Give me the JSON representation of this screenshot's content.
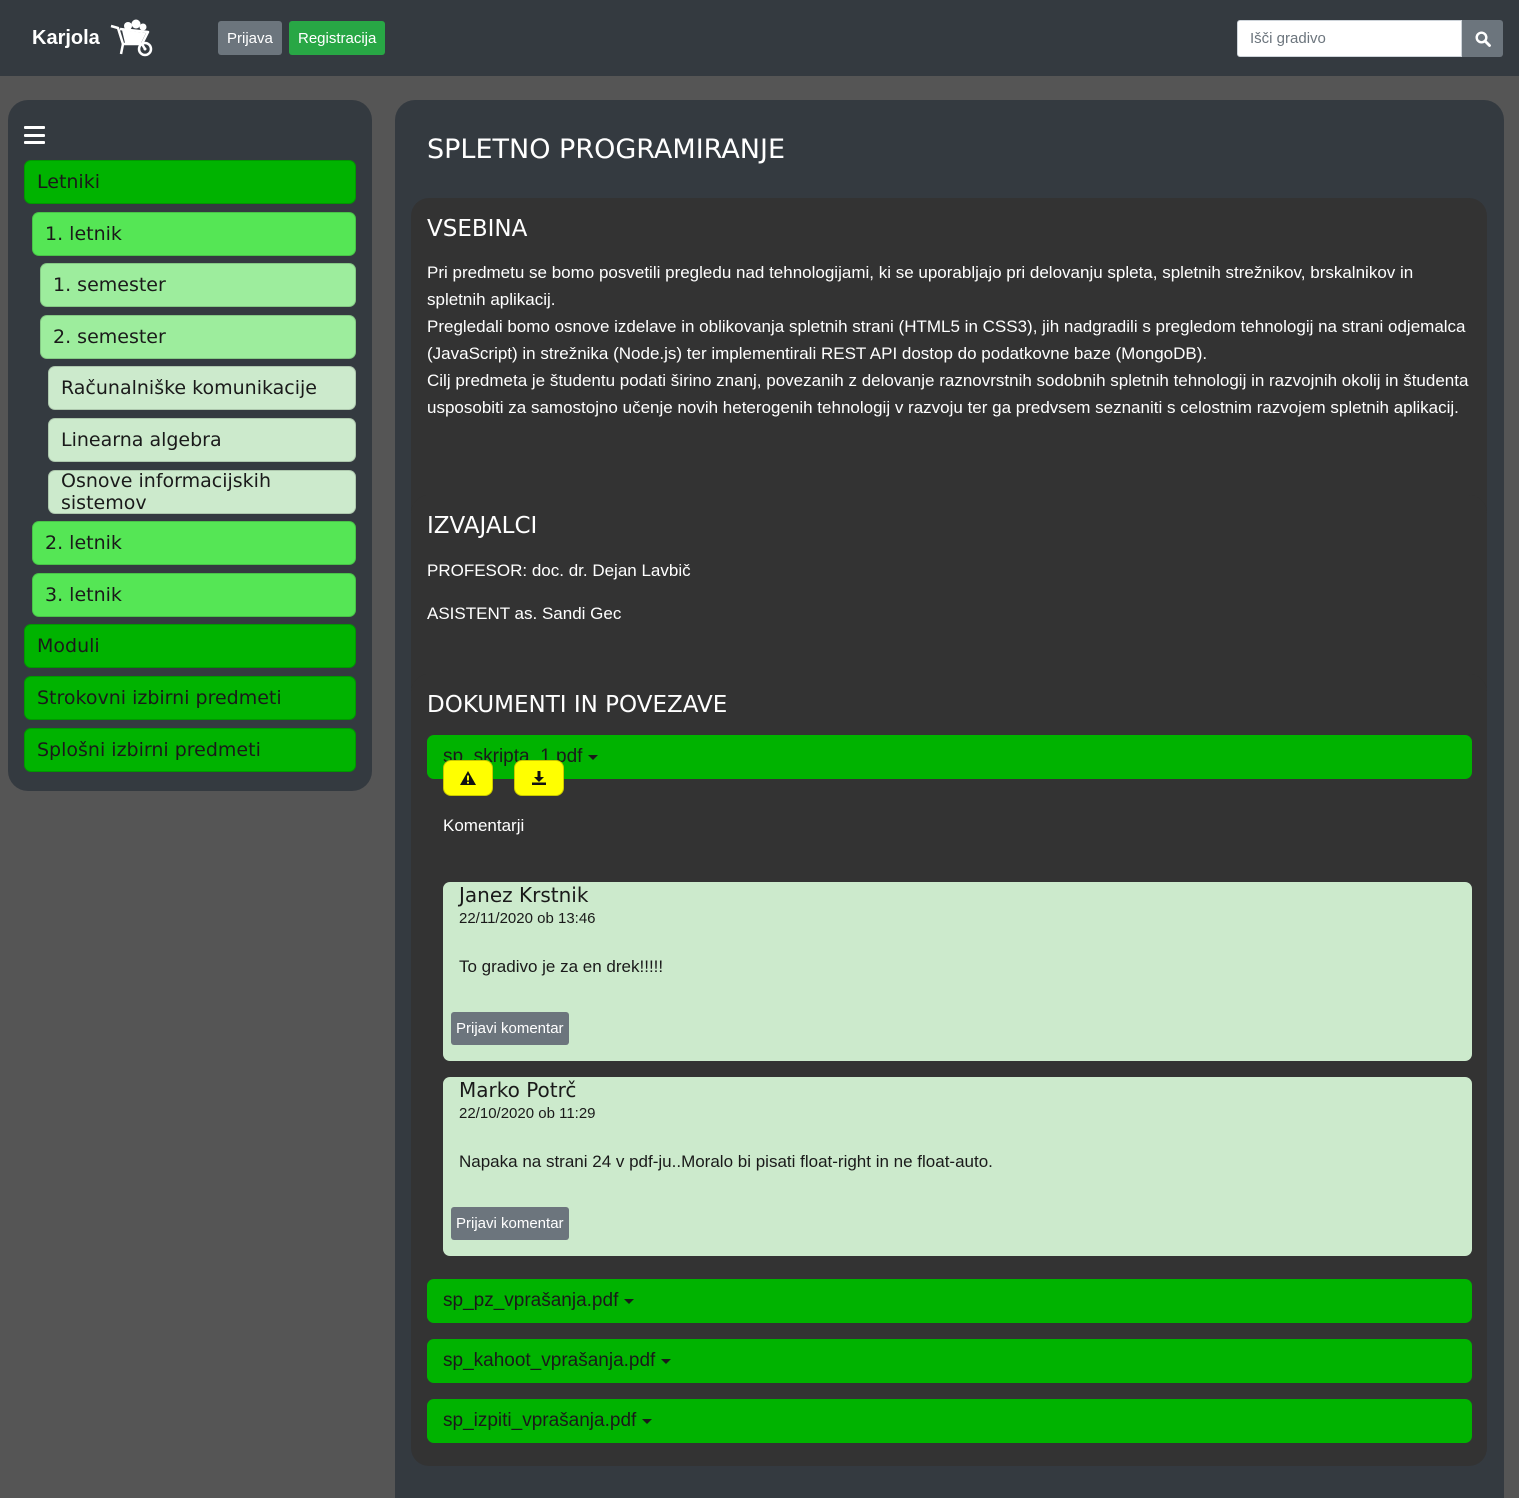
{
  "navbar": {
    "brand": "Karjola",
    "login_label": "Prijava",
    "register_label": "Registracija",
    "search_placeholder": "Išči gradivo",
    "search_icon": "search-icon"
  },
  "sidebar": {
    "menu_icon": "hamburger-menu-icon",
    "items": [
      {
        "label": "Letniki"
      },
      {
        "label": "1. letnik"
      },
      {
        "label": "1. semester"
      },
      {
        "label": "2. semester"
      },
      {
        "label": "Računalniške komunikacije"
      },
      {
        "label": "Linearna algebra"
      },
      {
        "label": "Osnove informacijskih sistemov"
      },
      {
        "label": "2. letnik"
      },
      {
        "label": "3. letnik"
      },
      {
        "label": "Moduli"
      },
      {
        "label": "Strokovni izbirni predmeti"
      },
      {
        "label": "Splošni izbirni predmeti"
      }
    ]
  },
  "main": {
    "title": "SPLETNO PROGRAMIRANJE",
    "vsebina": {
      "title": "VSEBINA",
      "p1": "Pri predmetu se bomo posvetili pregledu nad tehnologijami, ki se uporabljajo pri delovanju spleta, spletnih strežnikov, brskalnikov in spletnih aplikacij.",
      "p2": "Pregledali bomo osnove izdelave in oblikovanja spletnih strani (HTML5 in CSS3), jih nadgradili s pregledom tehnologij na strani odjemalca (JavaScript) in strežnika (Node.js) ter implementirali REST API dostop do podatkovne baze (MongoDB).",
      "p3": "Cilj predmeta je študentu podati širino znanj, povezanih z delovanje raznovrstnih sodobnih spletnih tehnologij in razvojnih okolij in študenta usposobiti za samostojno učenje novih heterogenih tehnologij v razvoju ter ga predvsem seznaniti s celostnim razvojem spletnih aplikacij."
    },
    "izvajalci": {
      "title": "IZVAJALCI",
      "profesor": "PROFESOR: doc. dr. Dejan Lavbič",
      "asistent": "ASISTENT as. Sandi Gec"
    },
    "dokumenti": {
      "title": "DOKUMENTI IN POVEZAVE",
      "files": [
        {
          "name": "sp_skripta_1.pdf"
        },
        {
          "name": "sp_pz_vprašanja.pdf"
        },
        {
          "name": "sp_kahoot_vprašanja.pdf"
        },
        {
          "name": "sp_izpiti_vprašanja.pdf"
        }
      ],
      "report_icon": "warning-icon",
      "download_icon": "download-icon",
      "comments_label": "Komentarji",
      "comments": [
        {
          "author": "Janez Krstnik",
          "date": "22/11/2020 ob 13:46",
          "text": "To gradivo je za en drek!!!!!",
          "report_label": "Prijavi komentar"
        },
        {
          "author": "Marko Potrč",
          "date": "22/10/2020 ob 11:29",
          "text": "Napaka na strani 24 v pdf-ju..Moralo bi pisati float-right in ne float-auto.",
          "report_label": "Prijavi komentar"
        }
      ]
    }
  },
  "colors": {
    "navbar": "#343a40",
    "page_bg": "#555555",
    "green_dark": "#00b300",
    "green_mid": "#55e655",
    "green_light": "#9ded9d",
    "green_pale": "#cceacc",
    "yellow": "#ffff00"
  }
}
